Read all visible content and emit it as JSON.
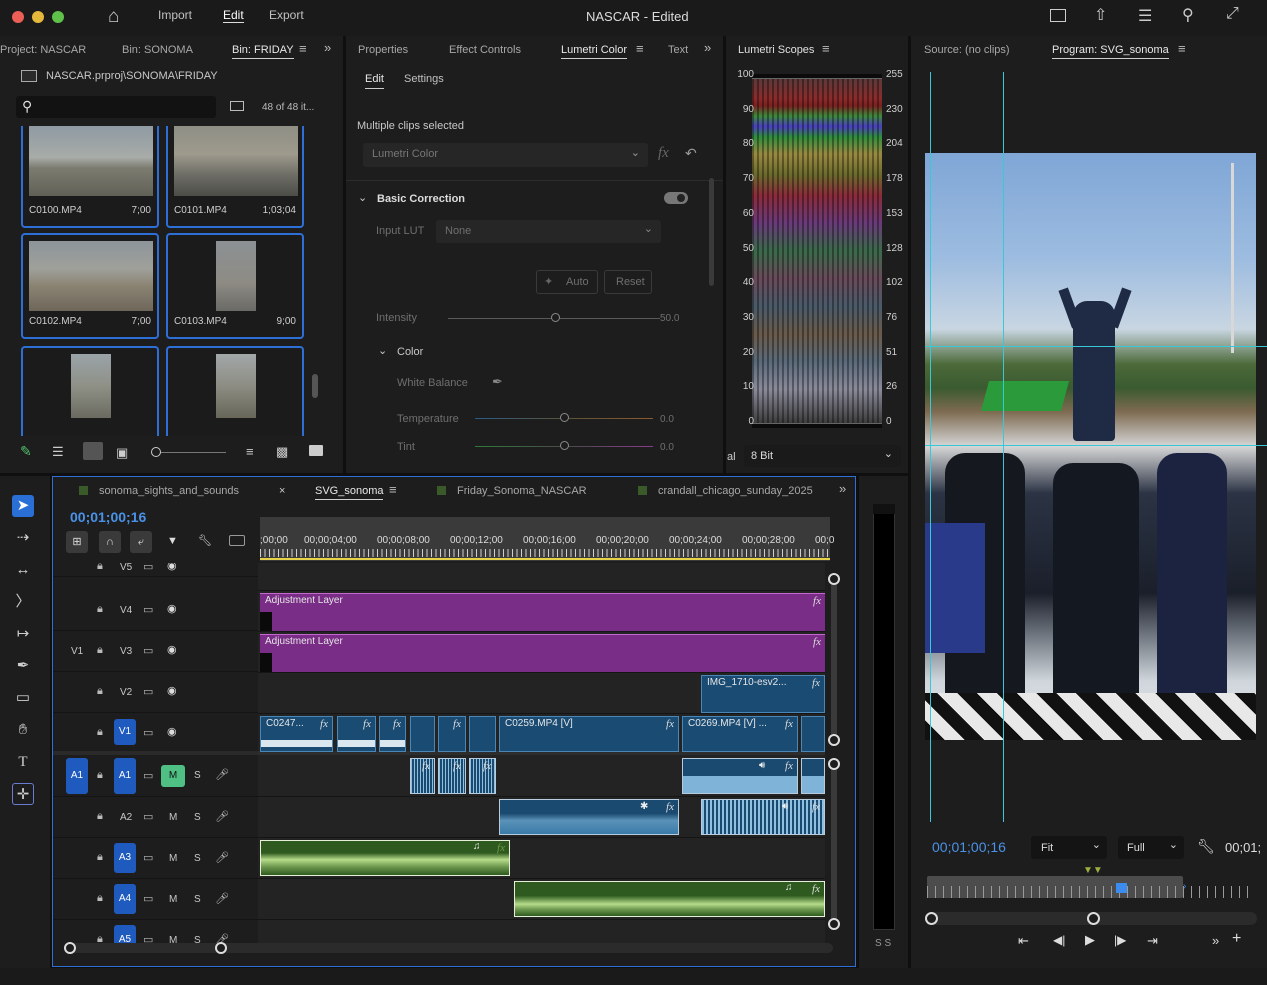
{
  "app": {
    "title": "NASCAR - Edited",
    "menus": [
      "Import",
      "Edit",
      "Export"
    ],
    "active_menu": "Edit"
  },
  "project_panel": {
    "tabs": [
      "Project: NASCAR",
      "Bin: SONOMA",
      "Bin: FRIDAY"
    ],
    "active_tab": "Bin: FRIDAY",
    "path": "NASCAR.prproj\\SONOMA\\FRIDAY",
    "search_placeholder": "",
    "item_count": "48 of 48 it...",
    "clips": [
      {
        "name": "C0100.MP4",
        "duration": "7;00"
      },
      {
        "name": "C0101.MP4",
        "duration": "1;03;04"
      },
      {
        "name": "C0102.MP4",
        "duration": "7;00"
      },
      {
        "name": "C0103.MP4",
        "duration": "9;00"
      },
      {
        "name": "",
        "duration": ""
      },
      {
        "name": "",
        "duration": ""
      }
    ]
  },
  "lumetri_panel": {
    "tabs": [
      "Properties",
      "Effect Controls",
      "Lumetri Color",
      "Text"
    ],
    "active_tab": "Lumetri Color",
    "subtabs": [
      "Edit",
      "Settings"
    ],
    "active_subtab": "Edit",
    "selection_label": "Multiple clips selected",
    "effect_dropdown": "Lumetri Color",
    "basic_correction": "Basic Correction",
    "input_lut_label": "Input LUT",
    "input_lut_value": "None",
    "auto_button": "Auto",
    "reset_button": "Reset",
    "intensity_label": "Intensity",
    "intensity_value": "50.0",
    "color_section": "Color",
    "white_balance_label": "White Balance",
    "temperature_label": "Temperature",
    "temperature_value": "0.0",
    "tint_label": "Tint",
    "tint_value": "0.0"
  },
  "scopes_panel": {
    "tab": "Lumetri Scopes",
    "left_scale": [
      "100",
      "90",
      "80",
      "70",
      "60",
      "50",
      "40",
      "30",
      "20",
      "10",
      "0"
    ],
    "right_scale": [
      "255",
      "230",
      "204",
      "178",
      "153",
      "128",
      "102",
      "76",
      "51",
      "26",
      "0"
    ],
    "bit_depth": "8 Bit",
    "left_label": "al"
  },
  "monitor_panel": {
    "tabs": [
      "Source: (no clips)",
      "Program: SVG_sonoma"
    ],
    "active_tab": "Program: SVG_sonoma",
    "timecode": "00;01;00;16",
    "fit": "Fit",
    "resolution": "Full",
    "end_timecode": "00;01;"
  },
  "timeline": {
    "tabs": [
      "sonoma_sights_and_sounds",
      "SVG_sonoma",
      "Friday_Sonoma_NASCAR",
      "crandall_chicago_sunday_2025"
    ],
    "active_tab": "SVG_sonoma",
    "timecode": "00;01;00;16",
    "ruler": [
      ";00;00",
      "00;00;04;00",
      "00;00;08;00",
      "00;00;12;00",
      "00;00;16;00",
      "00;00;20;00",
      "00;00;24;00",
      "00;00;28;00",
      "00;0"
    ],
    "tracks": [
      {
        "name": "V5",
        "kind": "video"
      },
      {
        "name": "V4",
        "kind": "video"
      },
      {
        "name": "V3",
        "kind": "video",
        "source": "V1"
      },
      {
        "name": "V2",
        "kind": "video"
      },
      {
        "name": "V1",
        "kind": "video"
      },
      {
        "name": "A1",
        "kind": "audio",
        "source": "A1"
      },
      {
        "name": "A2",
        "kind": "audio"
      },
      {
        "name": "A3",
        "kind": "audio"
      },
      {
        "name": "A4",
        "kind": "audio"
      },
      {
        "name": "A5",
        "kind": "audio"
      }
    ],
    "mute": "M",
    "solo": "S",
    "clips": {
      "adj1": "Adjustment Layer",
      "adj2": "Adjustment Layer",
      "img": "IMG_1710-esv2...",
      "c0247": "C0247...",
      "c0259": "C0259.MP4 [V]",
      "c0269": "C0269.MP4 [V] ..."
    },
    "meter_label": "S S"
  }
}
